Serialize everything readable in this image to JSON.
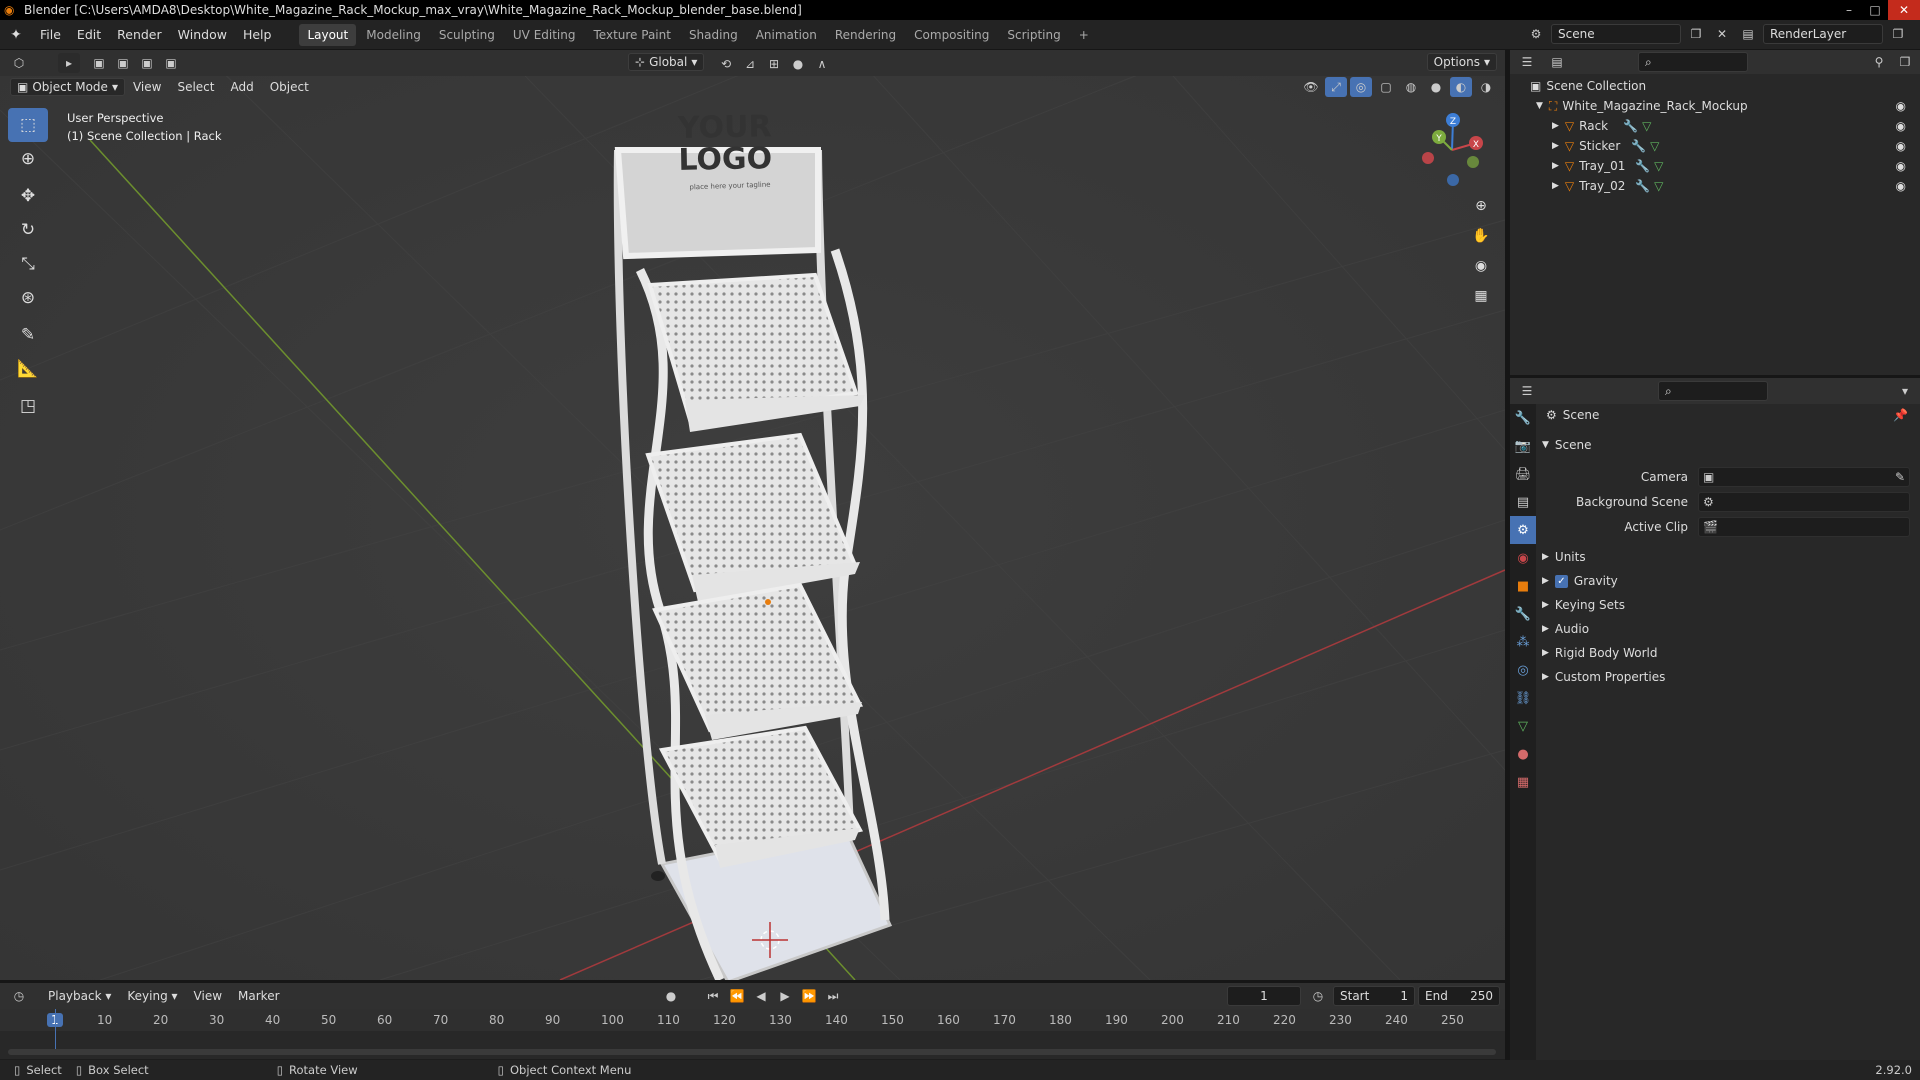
{
  "window": {
    "title": "Blender [C:\\Users\\AMDA8\\Desktop\\White_Magazine_Rack_Mockup_max_vray\\White_Magazine_Rack_Mockup_blender_base.blend]",
    "controls": [
      "–",
      "□",
      "✕"
    ]
  },
  "menu": [
    "File",
    "Edit",
    "Render",
    "Window",
    "Help"
  ],
  "workspaces": [
    "Layout",
    "Modeling",
    "Sculpting",
    "UV Editing",
    "Texture Paint",
    "Shading",
    "Animation",
    "Rendering",
    "Compositing",
    "Scripting"
  ],
  "active_workspace": "Layout",
  "add_workspace": "+",
  "scene_selector": "Scene",
  "render_layer": "RenderLayer",
  "viewport": {
    "mode": "Object Mode",
    "menus": [
      "View",
      "Select",
      "Add",
      "Object"
    ],
    "transform_orientation": "Global",
    "options": "Options",
    "perspective_label": "User Perspective",
    "collection_label": "(1) Scene Collection | Rack",
    "logo_line1": "YOUR",
    "logo_line2": "LOGO",
    "tagline": "place here your tagline",
    "gizmo": {
      "x": "X",
      "y": "Y",
      "z": "Z"
    },
    "nav_icons": [
      "zoom-icon",
      "hand-icon",
      "camera-icon",
      "grid-icon"
    ]
  },
  "toolbar": [
    "select-box",
    "cursor",
    "move",
    "rotate",
    "scale",
    "transform",
    "annotate",
    "measure",
    "add-cube"
  ],
  "outliner": {
    "root": "Scene Collection",
    "collection": "White_Magazine_Rack_Mockup",
    "objects": [
      "Rack",
      "Sticker",
      "Tray_01",
      "Tray_02"
    ]
  },
  "properties": {
    "header": "Scene",
    "section": "Scene",
    "fields": [
      {
        "label": "Camera"
      },
      {
        "label": "Background Scene"
      },
      {
        "label": "Active Clip"
      }
    ],
    "panels": [
      "Units",
      "Gravity",
      "Keying Sets",
      "Audio",
      "Rigid Body World",
      "Custom Properties"
    ],
    "gravity_checked": true
  },
  "timeline": {
    "menus": [
      "Playback",
      "Keying",
      "View",
      "Marker"
    ],
    "current_frame": "1",
    "start_label": "Start",
    "start": "1",
    "end_label": "End",
    "end": "250",
    "ticks": [
      "1",
      "10",
      "20",
      "30",
      "40",
      "50",
      "60",
      "70",
      "80",
      "90",
      "100",
      "110",
      "120",
      "130",
      "140",
      "150",
      "160",
      "170",
      "180",
      "190",
      "200",
      "210",
      "220",
      "230",
      "240",
      "250"
    ]
  },
  "status": {
    "select": "Select",
    "box_select": "Box Select",
    "rotate_view": "Rotate View",
    "context_menu": "Object Context Menu",
    "version": "2.92.0"
  },
  "colors": {
    "accent": "#4772b3",
    "active_orange": "#e87d0d",
    "x_axis": "#c8464a",
    "y_axis": "#7dab3e",
    "z_axis": "#3d7ed6"
  }
}
